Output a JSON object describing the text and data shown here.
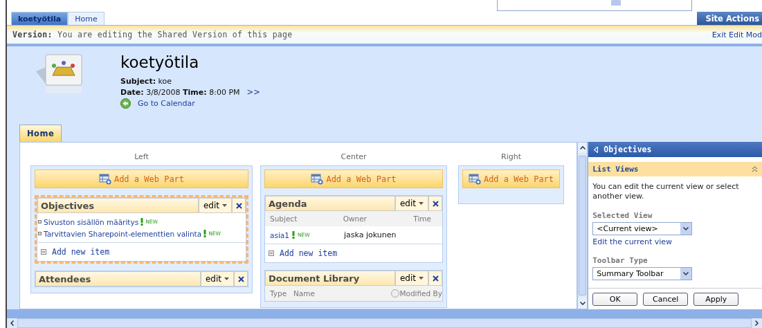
{
  "top_tabs": [
    {
      "label": "koetyötila",
      "selected": true
    },
    {
      "label": "Home",
      "selected": false
    }
  ],
  "site_actions": "Site Actions",
  "version_bar": {
    "label": "Version:",
    "text": "You are editing the Shared Version of this page",
    "exit_link": "Exit Edit Mod"
  },
  "meeting": {
    "title": "koetyötila",
    "subject_label": "Subject:",
    "subject": "koe",
    "date_label": "Date:",
    "date": "3/8/2008",
    "time_label": "Time:",
    "time": "8:00 PM",
    "more": ">>",
    "calendar_link": "Go to Calendar"
  },
  "page_tabs": [
    {
      "label": "Home",
      "selected": true
    }
  ],
  "zones": [
    {
      "label": "Left",
      "add_button": "Add a Web Part",
      "web_parts": [
        {
          "kind": "list",
          "title": "Objectives",
          "selected": true,
          "edit": "edit",
          "items": [
            {
              "text": "Sivuston sisällön määritys",
              "badge": "NEW"
            },
            {
              "text": "Tarvittavien Sharepoint-elementtien valinta",
              "badge": "NEW"
            }
          ],
          "add_item": "Add new item"
        },
        {
          "kind": "header",
          "title": "Attendees",
          "selected": false,
          "edit": "edit"
        }
      ]
    },
    {
      "label": "Center",
      "add_button": "Add a Web Part",
      "web_parts": [
        {
          "kind": "table",
          "title": "Agenda",
          "selected": false,
          "edit": "edit",
          "columns": [
            "Subject",
            "Owner",
            "Time"
          ],
          "rows": [
            {
              "subject": "asia1",
              "badge": "NEW",
              "owner": "jaska jokunen"
            }
          ],
          "add_item": "Add new item"
        },
        {
          "kind": "table",
          "title": "Document Library",
          "selected": false,
          "edit": "edit",
          "columns": [
            "Type",
            "Name",
            "Modified By"
          ]
        }
      ]
    },
    {
      "label": "Right",
      "add_button": "Add a Web Part"
    }
  ],
  "tool_pane": {
    "title": "Objectives",
    "section": "List Views",
    "description": "You can edit the current view or select another view.",
    "selected_view_label": "Selected View",
    "selected_view": "<Current view>",
    "edit_view_link": "Edit the current view",
    "toolbar_type_label": "Toolbar Type",
    "toolbar_type": "Summary Toolbar",
    "buttons": [
      "OK",
      "Cancel",
      "Apply"
    ]
  }
}
